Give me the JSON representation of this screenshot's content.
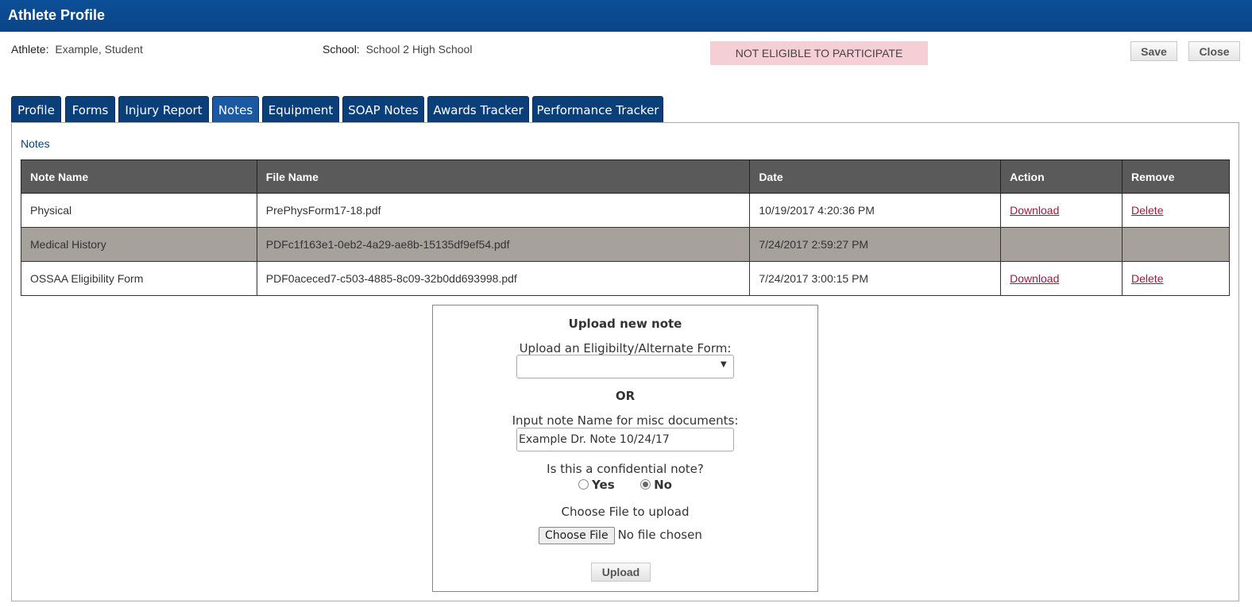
{
  "window": {
    "title": "Athlete Profile"
  },
  "header": {
    "athlete_label": "Athlete:",
    "athlete_value": "Example, Student",
    "school_label": "School:",
    "school_value": "School 2 High School",
    "eligibility": "NOT ELIGIBLE TO PARTICIPATE",
    "save_label": "Save",
    "close_label": "Close"
  },
  "tabs": [
    {
      "label": "Profile"
    },
    {
      "label": "Forms"
    },
    {
      "label": "Injury Report"
    },
    {
      "label": "Notes"
    },
    {
      "label": "Equipment"
    },
    {
      "label": "SOAP Notes"
    },
    {
      "label": "Awards Tracker"
    },
    {
      "label": "Performance Tracker"
    }
  ],
  "notes": {
    "title": "Notes",
    "columns": [
      "Note Name",
      "File Name",
      "Date",
      "Action",
      "Remove"
    ],
    "rows": [
      {
        "note": "Physical",
        "file": "PrePhysForm17-18.pdf",
        "date": "10/19/2017 4:20:36 PM",
        "action": "Download",
        "remove": "Delete"
      },
      {
        "note": "Medical History",
        "file": "PDFc1f163e1-0eb2-4a29-ae8b-15135df9ef54.pdf",
        "date": "7/24/2017 2:59:27 PM",
        "action": "",
        "remove": ""
      },
      {
        "note": "OSSAA Eligibility Form",
        "file": "PDF0aceced7-c503-4885-8c09-32b0dd693998.pdf",
        "date": "7/24/2017 3:00:15 PM",
        "action": "Download",
        "remove": "Delete"
      }
    ]
  },
  "upload": {
    "heading": "Upload new note",
    "form_label": "Upload an Eligibilty/Alternate Form:",
    "form_value": "",
    "or_label": "OR",
    "name_label": "Input note Name for misc documents:",
    "name_value": "Example Dr. Note 10/24/17",
    "confidential_label": "Is this a confidential note?",
    "yes_label": "Yes",
    "no_label": "No",
    "confidential_selected": "No",
    "choose_label": "Choose File to upload",
    "choose_button": "Choose File",
    "no_file": "No file chosen",
    "upload_button": "Upload"
  }
}
